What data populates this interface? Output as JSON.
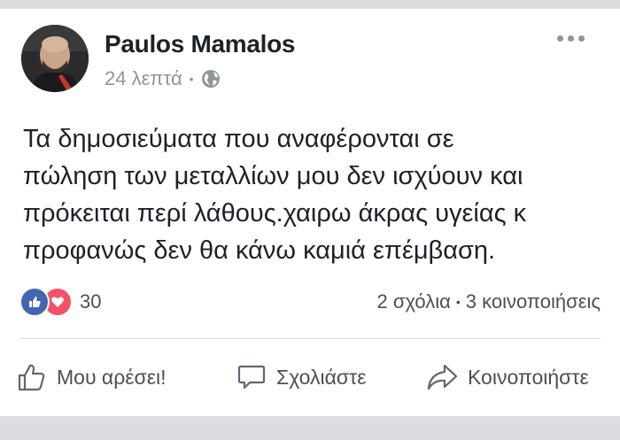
{
  "post": {
    "author": "Paulos Mamalos",
    "time": "24 λεπτά",
    "separator": "•",
    "text_lines": [
      "Τα δημοσιεύματα που αναφέρονται σε",
      "πώληση των μεταλλίων μου δεν ισχύουν και",
      "πρόκειται περί λάθους.χαιρω άκρας υγείας κ",
      "προφανώς δεν θα κάνω καμιά επέμβαση."
    ]
  },
  "reactions": {
    "count": "30",
    "icons": [
      "like-reaction-icon",
      "love-reaction-icon"
    ]
  },
  "stats": {
    "comments": "2 σχόλια",
    "separator": "•",
    "shares": "3 κοινοποιήσεις"
  },
  "actions": {
    "like": "Μου αρέσει!",
    "comment": "Σχολιάστε",
    "share": "Κοινοποιήστε"
  },
  "colors": {
    "like_blue": "#4267b2",
    "love_red": "#f25268",
    "text": "#1d2129",
    "muted": "#90949c"
  }
}
